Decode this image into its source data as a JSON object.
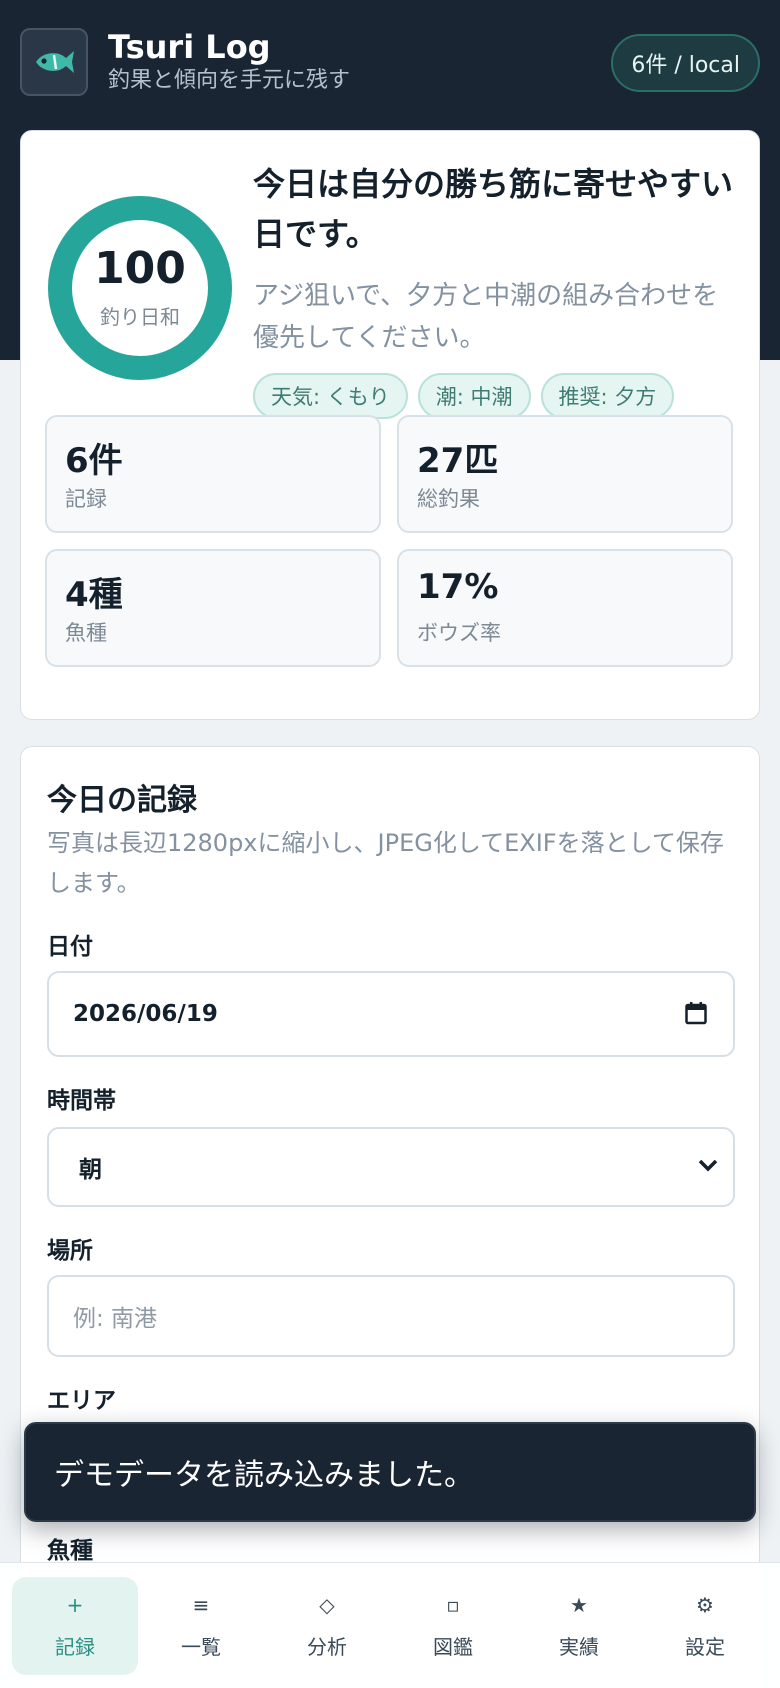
{
  "header": {
    "title": "Tsuri Log",
    "subtitle": "釣果と傾向を手元に残す",
    "count_pill": "6件 / local"
  },
  "score": {
    "value": "100",
    "label": "釣り日和",
    "fill_fraction": 1.0,
    "headline": "今日は自分の勝ち筋に寄せやすい日です。",
    "advice": "アジ狙いで、夕方と中潮の組み合わせを優先してください。",
    "chips": [
      "天気: くもり",
      "潮: 中潮",
      "推奨: 夕方"
    ],
    "accent_color": "#26a69a"
  },
  "stats": [
    {
      "value": "6件",
      "label": "記録"
    },
    {
      "value": "27匹",
      "label": "総釣果"
    },
    {
      "value": "4種",
      "label": "魚種"
    },
    {
      "value": "17%",
      "label": "ボウズ率"
    }
  ],
  "form": {
    "title": "今日の記録",
    "description": "写真は長辺1280pxに縮小し、JPEG化してEXIFを落として保存します。",
    "date_label": "日付",
    "date_value": "2026/06/19",
    "timeslot_label": "時間帯",
    "timeslot_value": "朝",
    "place_label": "場所",
    "place_placeholder": "例: 南港",
    "area_label": "エリア",
    "species_label": "魚種"
  },
  "toast": {
    "message": "デモデータを読み込みました。"
  },
  "nav": [
    {
      "icon": "+",
      "label": "記録",
      "icon_name": "plus-icon"
    },
    {
      "icon": "≡",
      "label": "一覧",
      "icon_name": "list-icon"
    },
    {
      "icon": "◇",
      "label": "分析",
      "icon_name": "diamond-icon"
    },
    {
      "icon": "▫",
      "label": "図鑑",
      "icon_name": "square-icon"
    },
    {
      "icon": "★",
      "label": "実績",
      "icon_name": "star-icon"
    },
    {
      "icon": "⚙",
      "label": "設定",
      "icon_name": "gear-icon"
    }
  ]
}
